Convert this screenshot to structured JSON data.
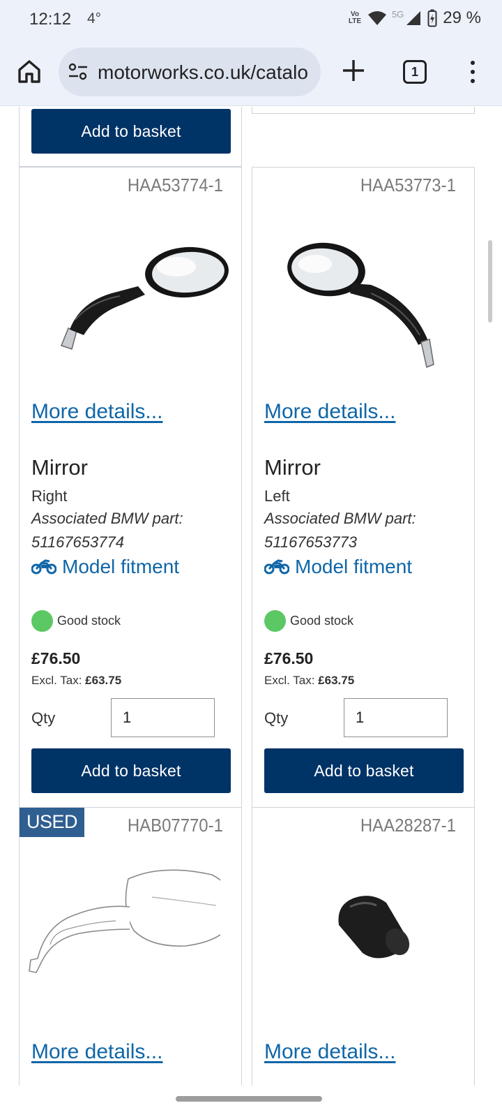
{
  "status_bar": {
    "time": "12:12",
    "temp": "4°",
    "network_top": "Vo",
    "network_bottom": "LTE",
    "network_5g": "5G",
    "battery": "29 %"
  },
  "browser": {
    "url": "motorworks.co.uk/catalo",
    "tab_count": "1"
  },
  "top_partial": {
    "add_button": "Add to basket"
  },
  "products": [
    {
      "sku": "HAA53774-1",
      "more": "More details...",
      "title": "Mirror",
      "side": "Right",
      "assoc_label": "Associated BMW part:",
      "assoc_number": "51167653774",
      "fitment": "Model fitment",
      "stock": "Good stock",
      "price": "£76.50",
      "excl_label": "Excl. Tax:",
      "excl_value": "£63.75",
      "qty_label": "Qty",
      "qty_value": "1",
      "add_button": "Add to basket"
    },
    {
      "sku": "HAA53773-1",
      "more": "More details...",
      "title": "Mirror",
      "side": "Left",
      "assoc_label": "Associated BMW part:",
      "assoc_number": "51167653773",
      "fitment": "Model fitment",
      "stock": "Good stock",
      "price": "£76.50",
      "excl_label": "Excl. Tax:",
      "excl_value": "£63.75",
      "qty_label": "Qty",
      "qty_value": "1",
      "add_button": "Add to basket"
    },
    {
      "badge": "USED",
      "sku": "HAB07770-1",
      "more": "More details..."
    },
    {
      "sku": "HAA28287-1",
      "more": "More details..."
    }
  ],
  "colors": {
    "button": "#003366",
    "link": "#0f66a8",
    "stock_dot": "#5cc864",
    "used_badge": "#2f5e91",
    "chrome_bg": "#edf1fa"
  }
}
